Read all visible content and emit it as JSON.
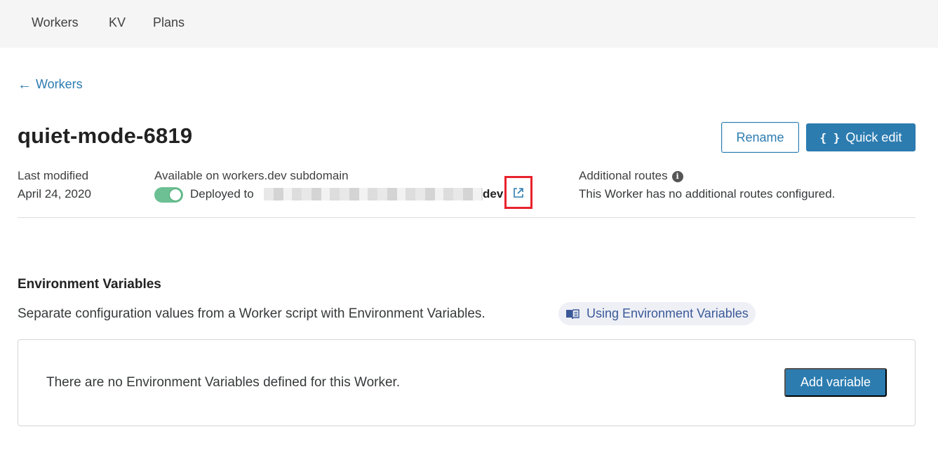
{
  "nav": {
    "items": [
      {
        "label": "Workers"
      },
      {
        "label": "KV"
      },
      {
        "label": "Plans"
      }
    ]
  },
  "back": {
    "arrow": "←",
    "label": "Workers"
  },
  "worker": {
    "name": "quiet-mode-6819",
    "rename_label": "Rename",
    "quick_edit_label": "Quick edit",
    "quick_edit_icon": "{ }"
  },
  "meta": {
    "last_modified_label": "Last modified",
    "last_modified_value": "April 24, 2020",
    "subdomain_label": "Available on workers.dev subdomain",
    "deployed_prefix": "Deployed to",
    "deployed_suffix": "dev",
    "subdomain_enabled": true,
    "routes_label": "Additional routes",
    "routes_value": "This Worker has no additional routes configured."
  },
  "env": {
    "title": "Environment Variables",
    "description": "Separate configuration values from a Worker script with Environment Variables.",
    "doc_link": "Using Environment Variables",
    "empty_text": "There are no Environment Variables defined for this Worker.",
    "add_label": "Add variable"
  },
  "colors": {
    "accent": "#2c7cb0",
    "toggle_on": "#6cc093",
    "highlight": "#e8222d"
  },
  "icons": {
    "external_link": "external-link-icon",
    "info": "info-icon",
    "book": "book-icon",
    "back_arrow": "arrow-left-icon"
  }
}
